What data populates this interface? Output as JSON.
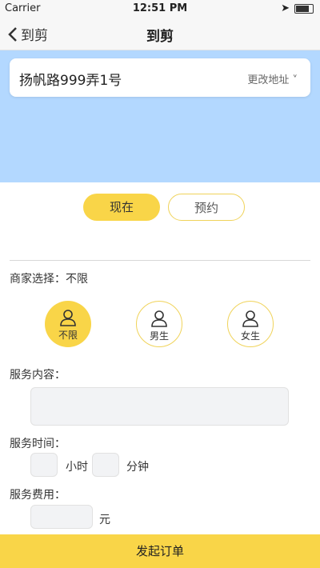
{
  "status_bar": {
    "carrier": "Carrier",
    "time": "12:51 PM"
  },
  "nav": {
    "back_label": "到剪",
    "title": "到剪"
  },
  "address": {
    "text": "扬帆路999弄1号",
    "change_label": "更改地址 ˅"
  },
  "time_mode": {
    "now_label": "现在",
    "book_label": "预约",
    "selected": "现在"
  },
  "merchant": {
    "label": "商家选择：",
    "value": "不限"
  },
  "gender_options": [
    {
      "label": "不限",
      "selected": true
    },
    {
      "label": "男生",
      "selected": false
    },
    {
      "label": "女生",
      "selected": false
    }
  ],
  "service_content": {
    "label": "服务内容：",
    "value": ""
  },
  "service_time": {
    "label": "服务时间：",
    "hours_unit": "小时",
    "minutes_unit": "分钟",
    "hours": "",
    "minutes": ""
  },
  "service_fee": {
    "label": "服务费用：",
    "unit": "元",
    "value": ""
  },
  "submit": {
    "label": "发起订单"
  },
  "colors": {
    "accent": "#f9d548",
    "map": "#b3d8ff"
  }
}
